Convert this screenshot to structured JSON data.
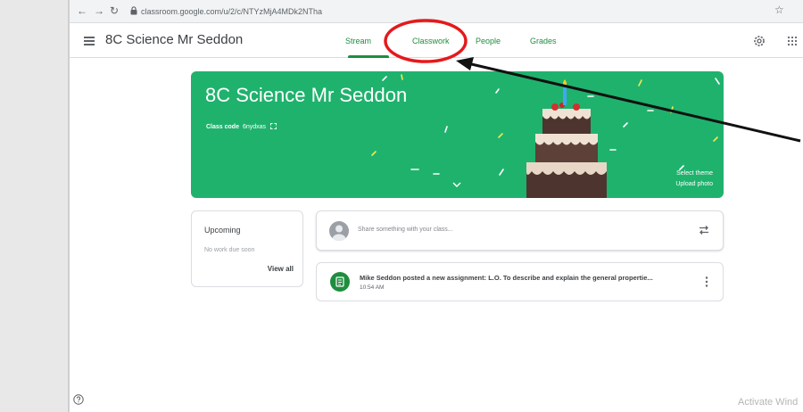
{
  "browser": {
    "url": "classroom.google.com/u/2/c/NTYzMjA4MDk2NTha"
  },
  "header": {
    "class_name": "8C Science Mr Seddon",
    "tabs": [
      {
        "label": "Stream",
        "active": true
      },
      {
        "label": "Classwork"
      },
      {
        "label": "People"
      },
      {
        "label": "Grades"
      }
    ]
  },
  "banner": {
    "title": "8C Science Mr Seddon",
    "class_code_label": "Class code",
    "class_code": "6nydxas",
    "select_theme": "Select theme",
    "upload_photo": "Upload photo",
    "color": "#1fb26d"
  },
  "upcoming": {
    "title": "Upcoming",
    "empty_text": "No work due soon",
    "view_all": "View all"
  },
  "share": {
    "placeholder": "Share something with your class..."
  },
  "posts": [
    {
      "title": "Mike Seddon posted a new assignment: L.O. To describe and explain the general propertie...",
      "time": "10:54 AM"
    }
  ],
  "watermark": "Activate Wind",
  "annotation": {
    "color": "#e5191b"
  }
}
